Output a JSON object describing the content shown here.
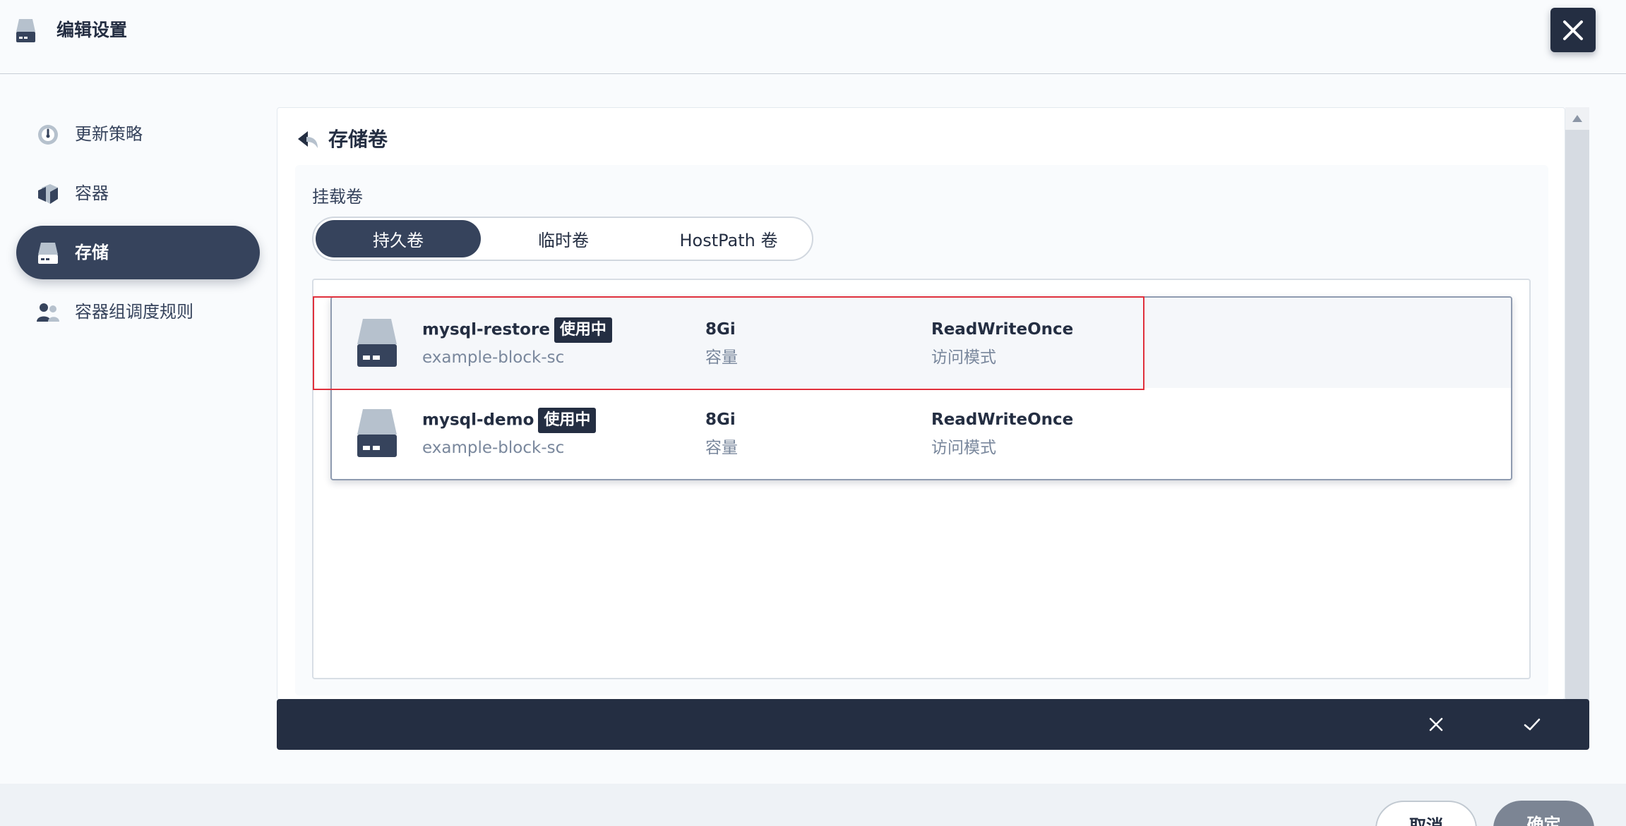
{
  "header": {
    "title": "编辑设置",
    "icon": "drive-icon",
    "close_icon": "close-icon"
  },
  "sidebar": {
    "items": [
      {
        "label": "更新策略",
        "icon": "gauge-icon",
        "active": false
      },
      {
        "label": "容器",
        "icon": "cube-icon",
        "active": false
      },
      {
        "label": "存储",
        "icon": "drive-icon",
        "active": true
      },
      {
        "label": "容器组调度规则",
        "icon": "users-icon",
        "active": false
      }
    ]
  },
  "panel": {
    "title": "存储卷",
    "back_icon": "back-arrow-icon",
    "mount_label": "挂载卷",
    "tabs": [
      {
        "label": "持久卷",
        "active": true
      },
      {
        "label": "临时卷",
        "active": false
      },
      {
        "label": "HostPath 卷",
        "active": false
      }
    ],
    "volumes": [
      {
        "name": "mysql-restore",
        "badge": "使用中",
        "storage_class": "example-block-sc",
        "capacity": "8Gi",
        "capacity_label": "容量",
        "access_mode": "ReadWriteOnce",
        "access_mode_label": "访问模式"
      },
      {
        "name": "mysql-demo",
        "badge": "使用中",
        "storage_class": "example-block-sc",
        "capacity": "8Gi",
        "capacity_label": "容量",
        "access_mode": "ReadWriteOnce",
        "access_mode_label": "访问模式"
      }
    ]
  },
  "action_bar": {
    "cancel_icon": "close-icon",
    "confirm_icon": "check-icon"
  },
  "footer": {
    "cancel_label": "取消",
    "ok_label": "确定"
  },
  "colors": {
    "primary_dark": "#242e42",
    "active_nav": "#36435c",
    "highlight_red": "#e0303c",
    "muted_text": "#79879c"
  }
}
